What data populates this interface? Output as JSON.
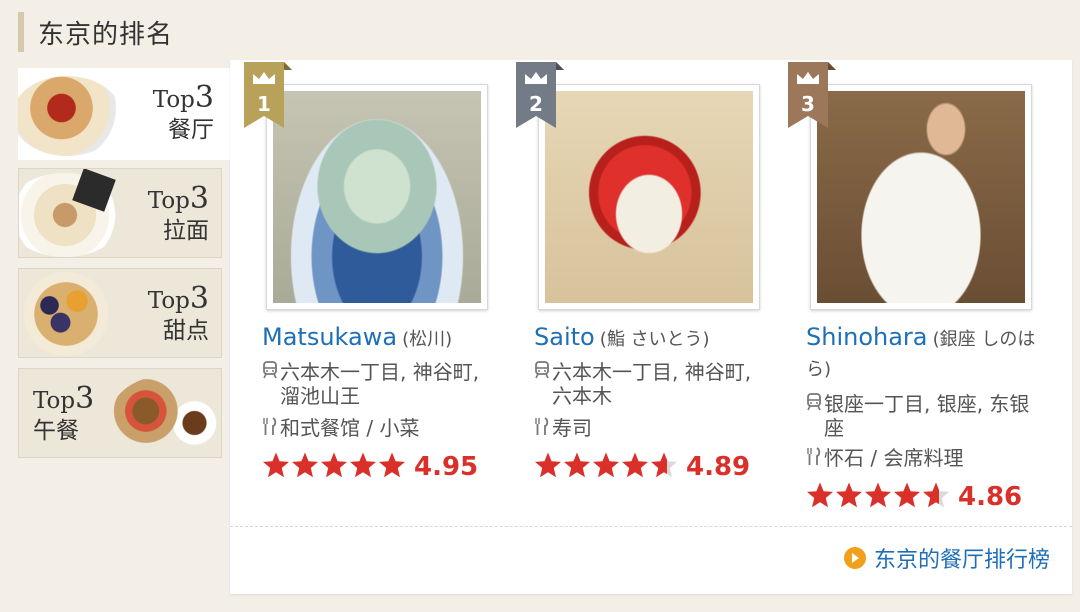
{
  "section_title": "东京的排名",
  "tabs": [
    {
      "top": "Top",
      "num": "3",
      "category": "餐厅",
      "active": true
    },
    {
      "top": "Top",
      "num": "3",
      "category": "拉面",
      "active": false
    },
    {
      "top": "Top",
      "num": "3",
      "category": "甜点",
      "active": false
    },
    {
      "top": "Top",
      "num": "3",
      "category": "午餐",
      "active": false
    }
  ],
  "cards": [
    {
      "rank": "1",
      "ribbon_color": "#b8a25a",
      "name": "Matsukawa",
      "name_jp": "(松川)",
      "stations": "六本木一丁目, 神谷町, 溜池山王",
      "cuisine": "和式餐馆 / 小菜",
      "rating": 4.95,
      "rating_text": "4.95"
    },
    {
      "rank": "2",
      "ribbon_color": "#737b86",
      "name": "Saito",
      "name_jp": "(鮨 さいとう)",
      "stations": "六本木一丁目, 神谷町, 六本木",
      "cuisine": "寿司",
      "rating": 4.89,
      "rating_text": "4.89"
    },
    {
      "rank": "3",
      "ribbon_color": "#9d7759",
      "name": "Shinohara",
      "name_jp": "(銀座 しのはら)",
      "stations": "银座一丁目, 银座, 东银座",
      "cuisine": "怀石 / 会席料理",
      "rating": 4.86,
      "rating_text": "4.86"
    }
  ],
  "footer_link": "东京的餐厅排行榜",
  "colors": {
    "accent_blue": "#1e6fb8",
    "star_red": "#d9302a",
    "link_arrow": "#f0a01a"
  }
}
